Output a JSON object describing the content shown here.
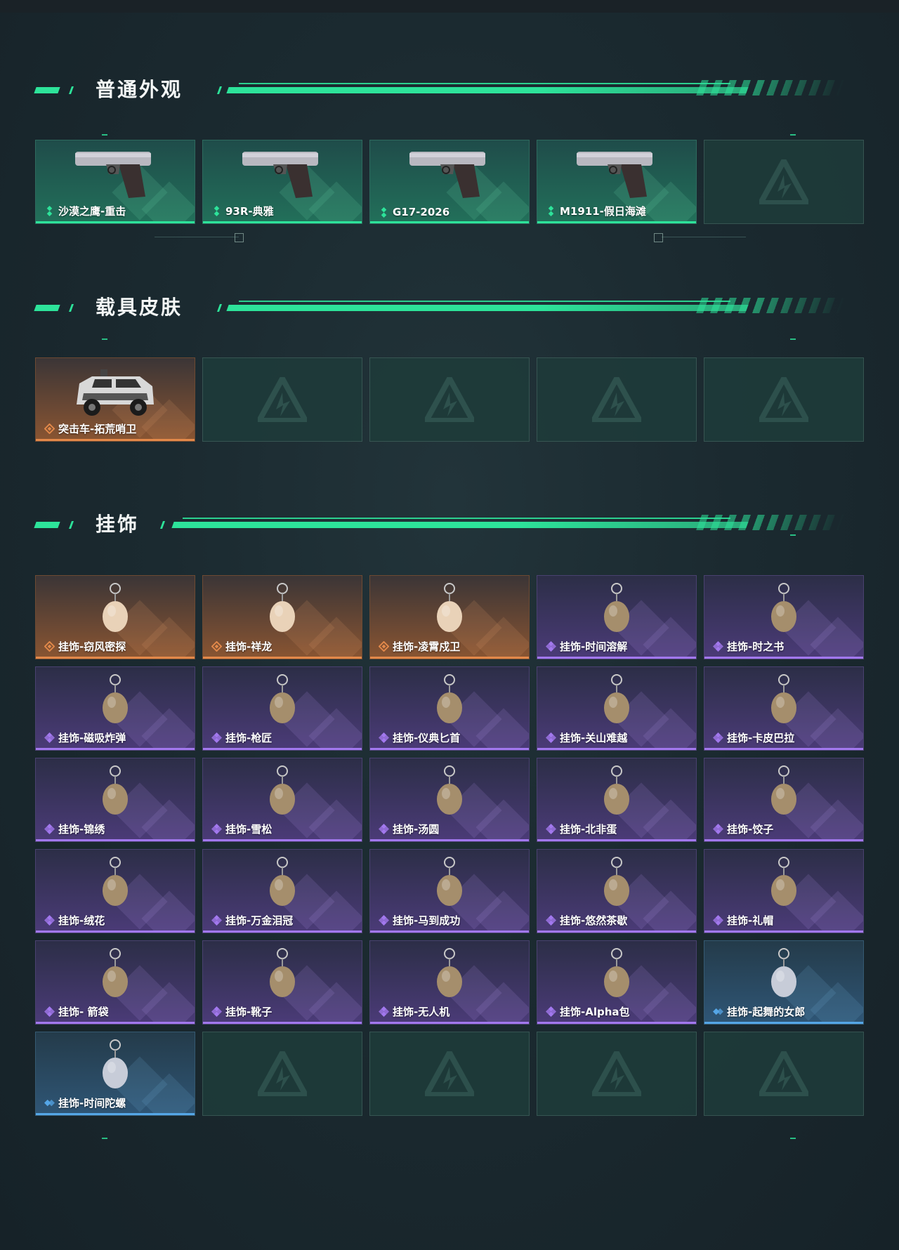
{
  "sections": [
    {
      "title": "普通外观",
      "items": [
        {
          "label": "沙漠之鹰-重击",
          "rarity": "green",
          "icon": "desert-eagle-pistol-icon"
        },
        {
          "label": "93R-典雅",
          "rarity": "green",
          "icon": "93r-pistol-icon"
        },
        {
          "label": "G17-2026",
          "rarity": "green",
          "icon": "g17-pistol-icon"
        },
        {
          "label": "M1911-假日海滩",
          "rarity": "green",
          "icon": "m1911-pistol-icon"
        },
        {
          "label": "",
          "rarity": "empty",
          "icon": "placeholder-logo-icon"
        }
      ]
    },
    {
      "title": "载具皮肤",
      "items": [
        {
          "label": "突击车-拓荒哨卫",
          "rarity": "orange",
          "icon": "assault-vehicle-icon"
        },
        {
          "label": "",
          "rarity": "empty",
          "icon": "placeholder-logo-icon"
        },
        {
          "label": "",
          "rarity": "empty",
          "icon": "placeholder-logo-icon"
        },
        {
          "label": "",
          "rarity": "empty",
          "icon": "placeholder-logo-icon"
        },
        {
          "label": "",
          "rarity": "empty",
          "icon": "placeholder-logo-icon"
        }
      ]
    },
    {
      "title": "挂饰",
      "items": [
        {
          "label": "挂饰-窃风密探",
          "rarity": "orange",
          "icon": "charm-icon"
        },
        {
          "label": "挂饰-祥龙",
          "rarity": "orange",
          "icon": "charm-icon"
        },
        {
          "label": "挂饰-凌霄戍卫",
          "rarity": "orange",
          "icon": "charm-icon"
        },
        {
          "label": "挂饰-时间溶解",
          "rarity": "purple",
          "icon": "charm-icon"
        },
        {
          "label": "挂饰-时之书",
          "rarity": "purple",
          "icon": "charm-icon"
        },
        {
          "label": "挂饰-磁吸炸弹",
          "rarity": "purple",
          "icon": "charm-icon"
        },
        {
          "label": "挂饰-枪匠",
          "rarity": "purple",
          "icon": "charm-icon"
        },
        {
          "label": "挂饰-仪典匕首",
          "rarity": "purple",
          "icon": "charm-icon"
        },
        {
          "label": "挂饰-关山难越",
          "rarity": "purple",
          "icon": "charm-icon"
        },
        {
          "label": "挂饰-卡皮巴拉",
          "rarity": "purple",
          "icon": "charm-icon"
        },
        {
          "label": "挂饰-锦绣",
          "rarity": "purple",
          "icon": "charm-icon"
        },
        {
          "label": "挂饰-雪松",
          "rarity": "purple",
          "icon": "charm-icon"
        },
        {
          "label": "挂饰-汤圆",
          "rarity": "purple",
          "icon": "charm-icon"
        },
        {
          "label": "挂饰-北非蛋",
          "rarity": "purple",
          "icon": "charm-icon"
        },
        {
          "label": "挂饰-饺子",
          "rarity": "purple",
          "icon": "charm-icon"
        },
        {
          "label": "挂饰-绒花",
          "rarity": "purple",
          "icon": "charm-icon"
        },
        {
          "label": "挂饰-万金泪冠",
          "rarity": "purple",
          "icon": "charm-icon"
        },
        {
          "label": "挂饰-马到成功",
          "rarity": "purple",
          "icon": "charm-icon"
        },
        {
          "label": "挂饰-悠然茶歇",
          "rarity": "purple",
          "icon": "charm-icon"
        },
        {
          "label": "挂饰-礼帽",
          "rarity": "purple",
          "icon": "charm-icon"
        },
        {
          "label": "挂饰- 箭袋",
          "rarity": "purple",
          "icon": "charm-icon"
        },
        {
          "label": "挂饰-靴子",
          "rarity": "purple",
          "icon": "charm-icon"
        },
        {
          "label": "挂饰-无人机",
          "rarity": "purple",
          "icon": "charm-icon"
        },
        {
          "label": "挂饰-Alpha包",
          "rarity": "purple",
          "icon": "charm-icon"
        },
        {
          "label": "挂饰-起舞的女郎",
          "rarity": "blue",
          "icon": "charm-icon"
        },
        {
          "label": "挂饰-时间陀螺",
          "rarity": "blue",
          "icon": "charm-icon"
        },
        {
          "label": "",
          "rarity": "empty",
          "icon": "placeholder-logo-icon"
        },
        {
          "label": "",
          "rarity": "empty",
          "icon": "placeholder-logo-icon"
        },
        {
          "label": "",
          "rarity": "empty",
          "icon": "placeholder-logo-icon"
        },
        {
          "label": "",
          "rarity": "empty",
          "icon": "placeholder-logo-icon"
        }
      ]
    }
  ],
  "colors": {
    "accent": "#2de39a",
    "green": "#2de39a",
    "orange": "#e3894a",
    "purple": "#a278ee",
    "blue": "#55a6e6"
  }
}
